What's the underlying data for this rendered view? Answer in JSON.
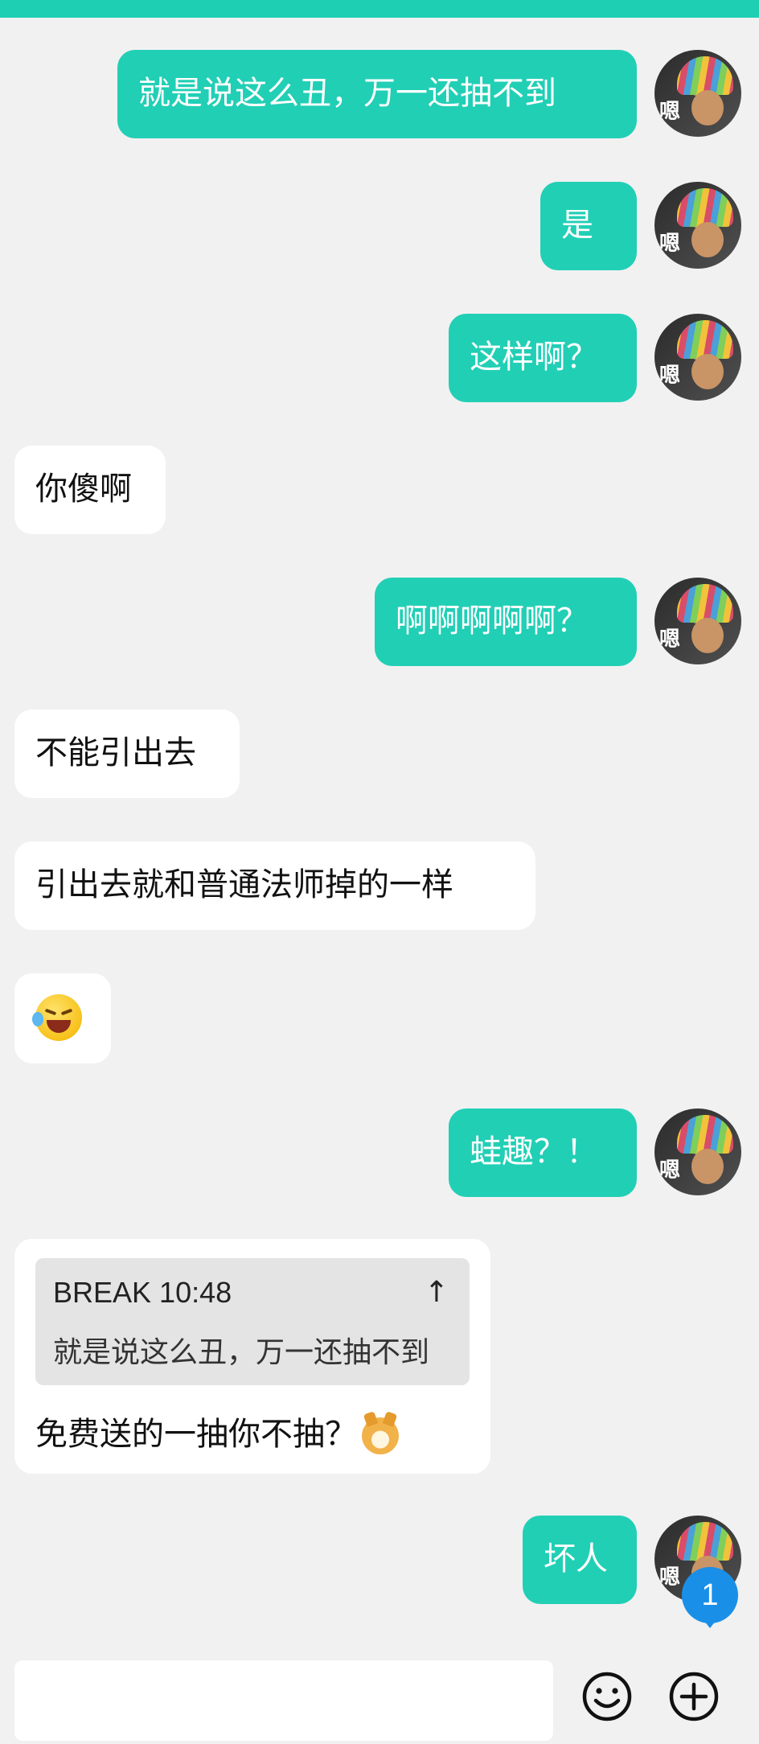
{
  "messages": [
    {
      "side": "me",
      "text": "就是说这么丑，万一还抽不到"
    },
    {
      "side": "me",
      "text": "是"
    },
    {
      "side": "me",
      "text": "这样啊？"
    },
    {
      "side": "them",
      "text": "你傻啊"
    },
    {
      "side": "me",
      "text": "啊啊啊啊啊？"
    },
    {
      "side": "them",
      "text": "不能引出去"
    },
    {
      "side": "them",
      "text": "引出去就和普通法师掉的一样"
    },
    {
      "side": "them",
      "emoji": "laughing-crying-emoji"
    },
    {
      "side": "me",
      "text": "蛙趣？！"
    },
    {
      "side": "them",
      "quote": {
        "author_time": "BREAK 10:48",
        "arrow": "↑",
        "text": "就是说这么丑，万一还抽不到"
      },
      "text": "免费送的一抽你不抽？",
      "emoji": "doge-emoji"
    },
    {
      "side": "me",
      "text": "坏人"
    }
  ],
  "avatar": {
    "caption": "嗯"
  },
  "badge": {
    "count": "1"
  },
  "input": {
    "value": "",
    "placeholder": ""
  },
  "colors": {
    "accent": "#21cfb5",
    "background": "#f1f1f1",
    "badge": "#1a8fe8"
  }
}
